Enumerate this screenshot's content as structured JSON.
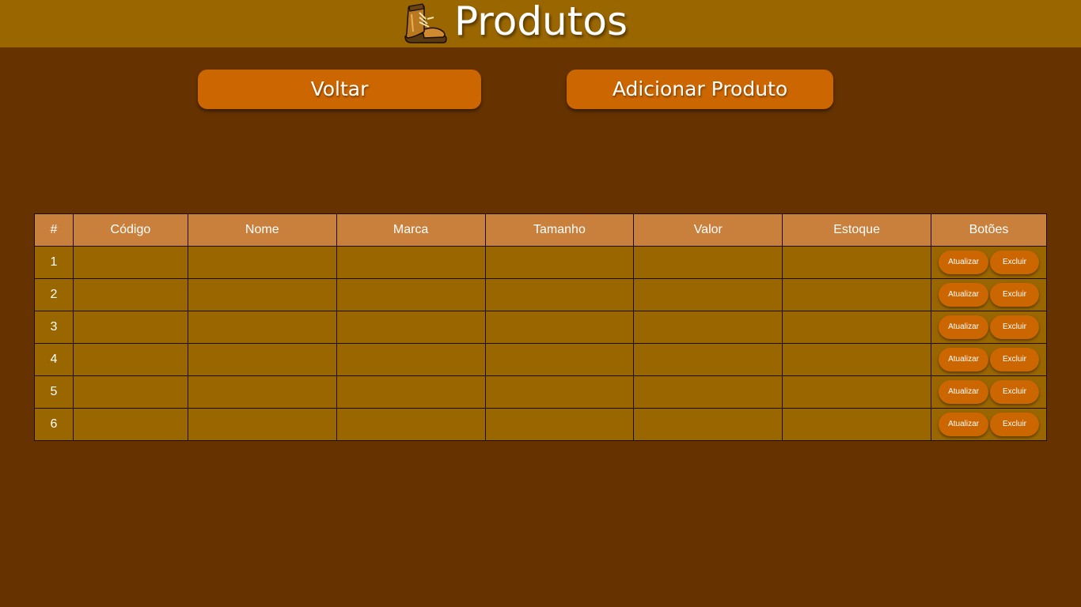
{
  "header": {
    "title": "Produtos",
    "icon": "boot-icon",
    "background": "#996600"
  },
  "actions": {
    "back_label": "Voltar",
    "add_label": "Adicionar Produto"
  },
  "table": {
    "headers": [
      "#",
      "Código",
      "Nome",
      "Marca",
      "Tamanho",
      "Valor",
      "Estoque",
      "Botões"
    ],
    "rows": [
      {
        "num": "1",
        "codigo": "",
        "nome": "",
        "marca": "",
        "tamanho": "",
        "valor": "",
        "estoque": ""
      },
      {
        "num": "2",
        "codigo": "",
        "nome": "",
        "marca": "",
        "tamanho": "",
        "valor": "",
        "estoque": ""
      },
      {
        "num": "3",
        "codigo": "",
        "nome": "",
        "marca": "",
        "tamanho": "",
        "valor": "",
        "estoque": ""
      },
      {
        "num": "4",
        "codigo": "",
        "nome": "",
        "marca": "",
        "tamanho": "",
        "valor": "",
        "estoque": ""
      },
      {
        "num": "5",
        "codigo": "",
        "nome": "",
        "marca": "",
        "tamanho": "",
        "valor": "",
        "estoque": ""
      },
      {
        "num": "6",
        "codigo": "",
        "nome": "",
        "marca": "",
        "tamanho": "",
        "valor": "",
        "estoque": ""
      }
    ],
    "update_label": "Atualizar",
    "delete_label": "Excluir"
  },
  "colors": {
    "page_background": "#663300",
    "header_background": "#996600",
    "button": "#cc6600",
    "table_header": "#c8803c",
    "table_cell": "#996600"
  }
}
